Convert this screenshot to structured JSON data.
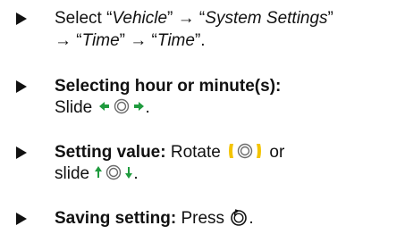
{
  "steps": [
    {
      "id": "select-menu",
      "line1": {
        "prefix": "Select “",
        "item1": "Vehicle",
        "sep1": "” → “",
        "item2": "System Settings",
        "end1": "”"
      },
      "line2": {
        "pre": "→ “",
        "item3": "Time",
        "sep": "” → “",
        "item4": "Time",
        "end": "”."
      }
    },
    {
      "id": "select-hour-minute",
      "heading": "Selecting hour or minute(s):",
      "text": "Slide",
      "control_icon": "slide-left-right-controller-icon",
      "end": "."
    },
    {
      "id": "set-value",
      "heading": "Setting value:",
      "text1": " Rotate",
      "rotate_icon": "rotate-controller-icon",
      "text2": "or",
      "text3": "slide",
      "slide_icon": "slide-up-down-controller-icon",
      "end": "."
    },
    {
      "id": "save-setting",
      "heading": "Saving setting:",
      "text": " Press",
      "press_icon": "press-controller-icon",
      "end": "."
    }
  ],
  "colors": {
    "text": "#111111",
    "arrow_green": "#1f9b3e",
    "rotate_yellow": "#f4c400",
    "controller_gray": "#6b6b6b"
  }
}
